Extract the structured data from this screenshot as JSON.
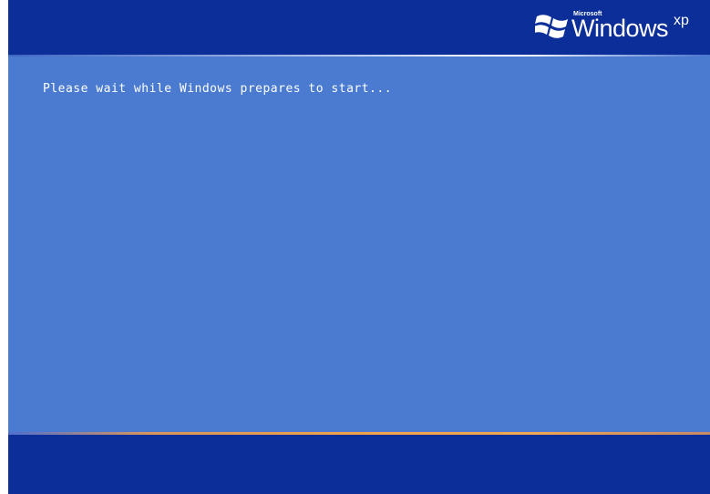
{
  "boot_screen": {
    "status_message": "Please wait while Windows prepares to start..."
  },
  "logo": {
    "maker": "Microsoft",
    "product": "Windows",
    "edition": "xp",
    "icon": "windows-flag-icon"
  },
  "colors": {
    "band": "#0b2e99",
    "panel": "#4a7bd0",
    "accent": "#f2a34a",
    "text": "#ffffff"
  }
}
